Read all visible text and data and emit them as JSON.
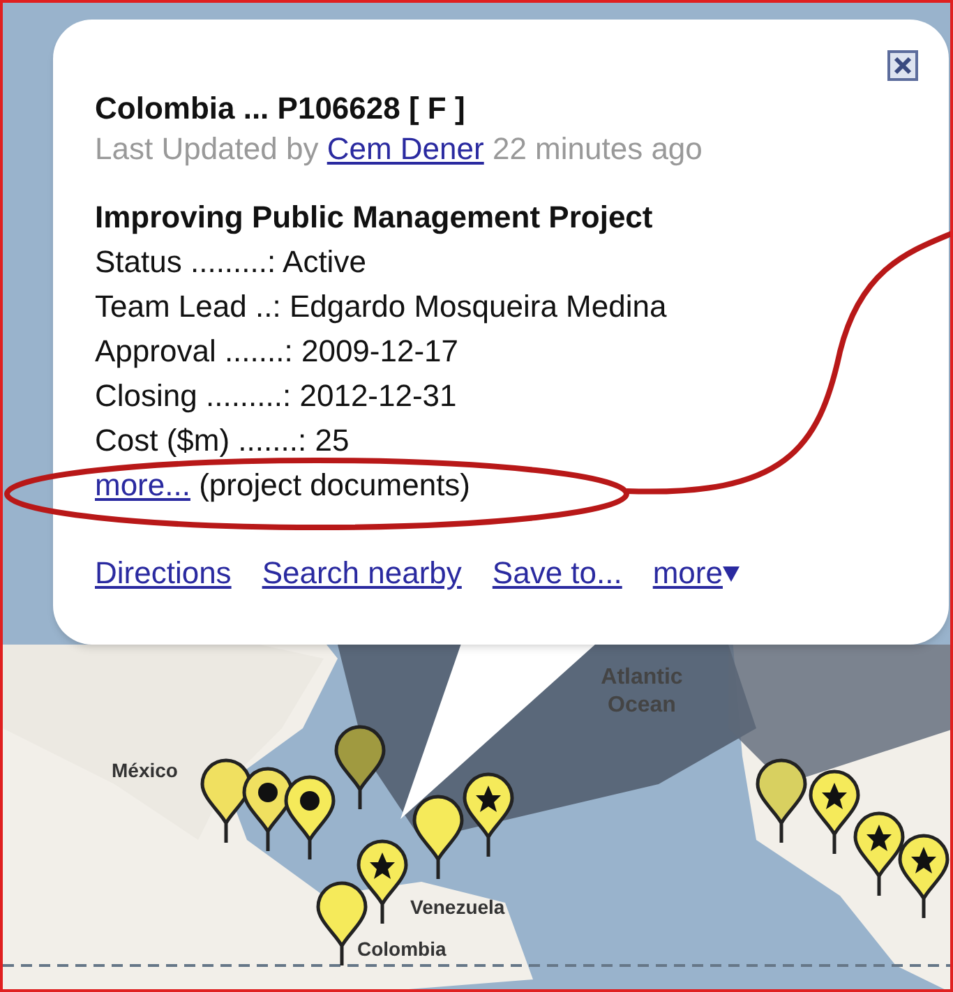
{
  "info_window": {
    "title": "Colombia ... P106628 [ F ]",
    "updated": {
      "prefix": "Last Updated by",
      "author": "Cem Dener",
      "suffix": "22 minutes ago"
    },
    "project": "Improving Public Management Project",
    "fields": [
      {
        "label": "Status .........:",
        "value": "Active"
      },
      {
        "label": "Team Lead ..:",
        "value": "Edgardo Mosqueira Medina"
      },
      {
        "label": "Approval .......:",
        "value": "2009-12-17"
      },
      {
        "label": "Closing .........:",
        "value": "2012-12-31"
      },
      {
        "label": "Cost ($m) .......:",
        "value": "25"
      }
    ],
    "more_link": "more...",
    "more_note": "(project documents)",
    "actions": [
      {
        "label": "Directions",
        "kind": "link"
      },
      {
        "label": "Search nearby",
        "kind": "link"
      },
      {
        "label": "Save to...",
        "kind": "link"
      },
      {
        "label": "more",
        "kind": "menu"
      }
    ]
  },
  "map": {
    "labels": [
      {
        "text": "México",
        "kind": "country"
      },
      {
        "text": "Atlantic Ocean",
        "kind": "ocean"
      },
      {
        "text": "Venezuela",
        "kind": "country"
      },
      {
        "text": "Colombia",
        "kind": "country"
      }
    ]
  }
}
